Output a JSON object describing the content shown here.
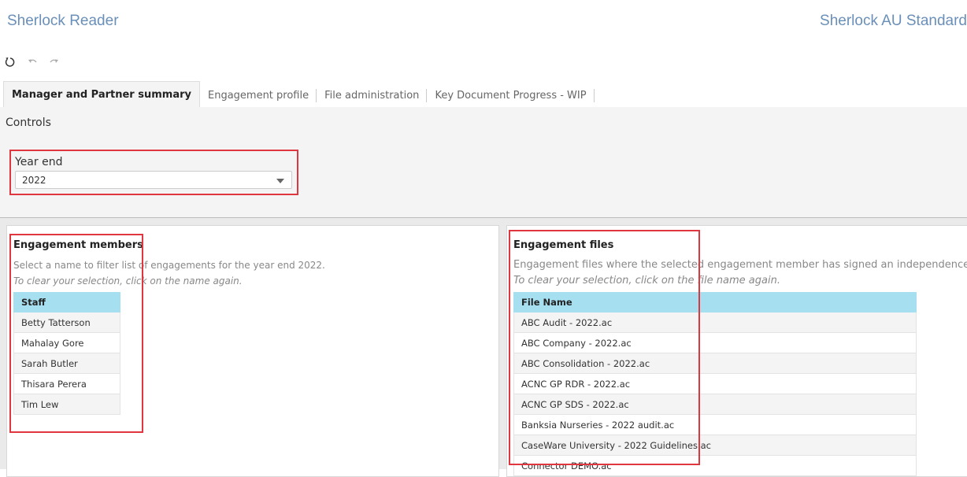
{
  "header": {
    "app_title": "Sherlock Reader",
    "template_title": "Sherlock AU Standard"
  },
  "toolbar": {
    "refresh_icon": "refresh-icon",
    "undo_icon": "undo-icon",
    "redo_icon": "redo-icon"
  },
  "tabs": [
    {
      "label": "Manager and Partner summary",
      "active": true
    },
    {
      "label": "Engagement profile"
    },
    {
      "label": "File administration"
    },
    {
      "label": "Key Document Progress - WIP"
    }
  ],
  "controls": {
    "title": "Controls",
    "year_end": {
      "label": "Year end",
      "value": "2022"
    }
  },
  "members": {
    "title": "Engagement members",
    "description": "Select a name to filter list of engagements for the year end 2022.",
    "hint": "To clear your selection, click on the name again.",
    "column": "Staff",
    "rows": [
      "Betty Tatterson",
      "Mahalay Gore",
      "Sarah Butler",
      "Thisara Perera",
      "Tim Lew"
    ]
  },
  "files": {
    "title": "Engagement files",
    "description": "Engagement files where the selected engagement member has signed an independence de",
    "hint": "To clear your selection, click on the file name again.",
    "column": "File Name",
    "rows": [
      "ABC Audit - 2022.ac",
      "ABC Company - 2022.ac",
      "ABC Consolidation - 2022.ac",
      "ACNC GP RDR - 2022.ac",
      "ACNC GP SDS - 2022.ac",
      "Banksia Nurseries - 2022 audit.ac",
      "CaseWare University - 2022 Guidelines.ac",
      "Connector DEMO.ac"
    ]
  },
  "colors": {
    "accent_title": "#6a8fb8",
    "header_cell": "#a6dff0",
    "highlight_box": "#e0363f"
  }
}
